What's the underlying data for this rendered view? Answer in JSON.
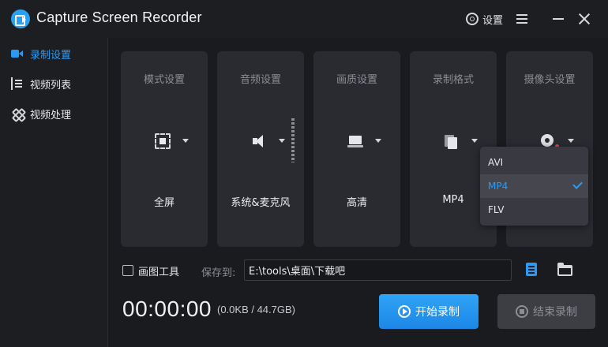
{
  "app": {
    "title": "Capture Screen Recorder",
    "settings_label": "设置"
  },
  "sidebar": {
    "items": [
      {
        "label": "录制设置",
        "icon": "camera-icon",
        "active": true
      },
      {
        "label": "视频列表",
        "icon": "list-icon"
      },
      {
        "label": "视频处理",
        "icon": "tools-icon"
      }
    ]
  },
  "cards": [
    {
      "title": "模式设置",
      "value": "全屏",
      "icon": "fullscreen-icon"
    },
    {
      "title": "音频设置",
      "value": "系统&麦克风",
      "icon": "speaker-icon"
    },
    {
      "title": "画质设置",
      "value": "高清",
      "icon": "laptop-icon"
    },
    {
      "title": "录制格式",
      "value": "MP4",
      "icon": "file-icon"
    },
    {
      "title": "摄像头设置",
      "value": "",
      "icon": "webcam-icon"
    }
  ],
  "format_dropdown": {
    "options": [
      "AVI",
      "MP4",
      "FLV"
    ],
    "selected": "MP4"
  },
  "bottom": {
    "drawing_tool_label": "画图工具",
    "save_to_label": "保存到:",
    "save_path": "E:\\tools\\桌面\\下载吧",
    "timer": "00:00:00",
    "size_info": "(0.0KB / 44.7GB)",
    "start_label": "开始录制",
    "stop_label": "结束录制"
  },
  "colors": {
    "accent": "#2b9af3",
    "background": "#1d1e22",
    "card": "#2a2b31"
  }
}
